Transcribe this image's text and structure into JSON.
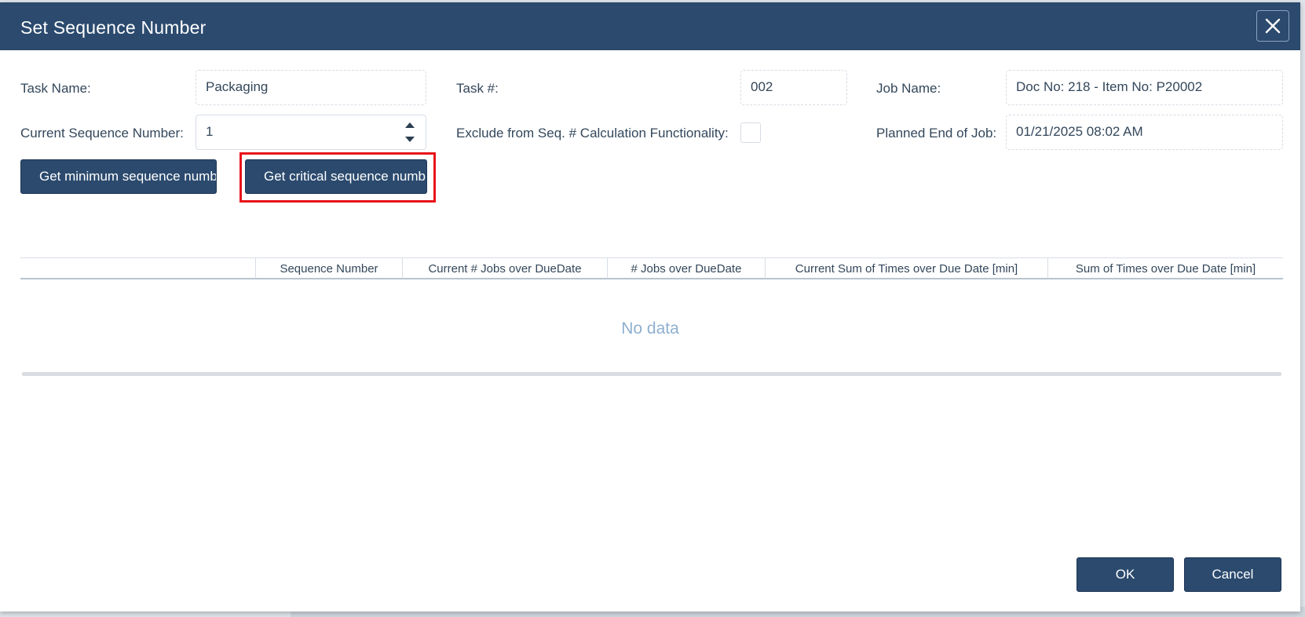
{
  "dialog": {
    "title": "Set Sequence Number",
    "close_icon": "close-icon"
  },
  "form": {
    "task_name_label": "Task Name:",
    "task_name_value": "Packaging",
    "task_no_label": "Task #:",
    "task_no_value": "002",
    "job_name_label": "Job Name:",
    "job_name_value": "Doc No: 218 - Item No: P20002",
    "current_seq_label": "Current Sequence Number:",
    "current_seq_value": "1",
    "exclude_label": "Exclude from Seq. # Calculation Functionality:",
    "exclude_checked": false,
    "planned_end_label": "Planned End of Job:",
    "planned_end_value": "01/21/2025 08:02 AM"
  },
  "actions": {
    "get_minimum_label": "Get minimum sequence numb",
    "get_critical_label": "Get critical sequence numb"
  },
  "grid": {
    "columns": [
      "",
      "Sequence Number",
      "Current # Jobs over DueDate",
      "# Jobs over DueDate",
      "Current Sum of Times over Due Date [min]",
      "Sum of Times over Due Date [min]"
    ],
    "empty_text": "No data"
  },
  "footer": {
    "ok_label": "OK",
    "cancel_label": "Cancel"
  },
  "colors": {
    "header": "#2b4a6e",
    "highlight": "#e8131a",
    "empty_text": "#8fb0cf"
  }
}
